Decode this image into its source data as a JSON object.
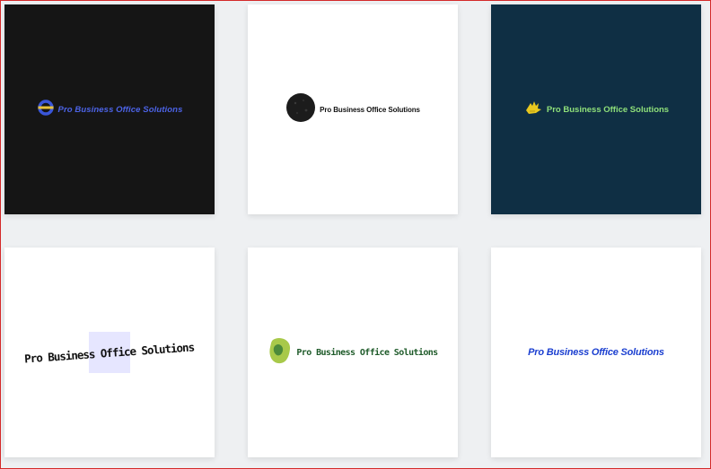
{
  "logos": [
    {
      "text": "Pro Business Office Solutions",
      "icon": "ring-icon",
      "bg": "#151515",
      "color": "#4c63e6"
    },
    {
      "text": "Pro Business Office Solutions",
      "icon": "dark-circle-icon",
      "bg": "#ffffff",
      "color": "#111111"
    },
    {
      "text": "Pro Business Office Solutions",
      "icon": "hand-icon",
      "bg": "#0f2f44",
      "color": "#8fe07a"
    },
    {
      "text": "Pro Business Office Solutions",
      "icon": "none",
      "bg": "#ffffff",
      "color": "#111111"
    },
    {
      "text": "Pro Business Office Solutions",
      "icon": "green-blob-icon",
      "bg": "#ffffff",
      "color": "#1f5b2a"
    },
    {
      "text": "Pro Business Office Solutions",
      "icon": "none",
      "bg": "#ffffff",
      "color": "#1b3fd0"
    }
  ]
}
